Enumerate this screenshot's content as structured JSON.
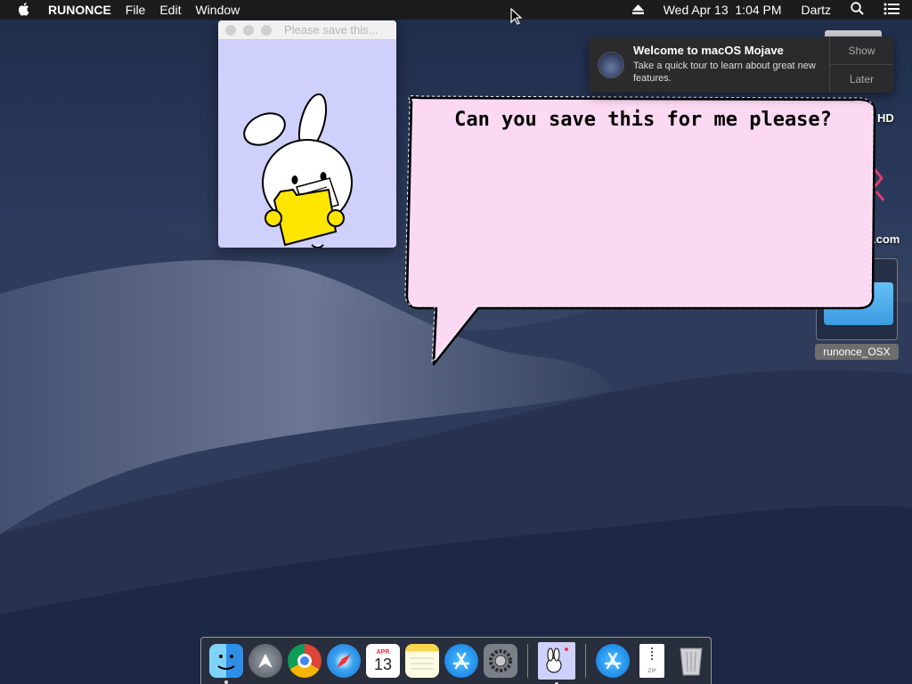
{
  "menubar": {
    "app_name": "RUNONCE",
    "menus": [
      "File",
      "Edit",
      "Window"
    ],
    "date_time": "Wed Apr 13  1:04 PM",
    "user": "Dartz"
  },
  "app_window": {
    "title": "Please save this..."
  },
  "speech_bubble": {
    "text": "Can you save this for me please?"
  },
  "notification": {
    "title": "Welcome to macOS Mojave",
    "body": "Take a quick tour to learn about great new features.",
    "show_label": "Show",
    "later_label": "Later"
  },
  "desktop": {
    "partial_label_1": "HD",
    "partial_label_2": ".com",
    "folder_label": "runonce_OSX"
  },
  "dock": {
    "calendar_month": "APR",
    "calendar_day": "13",
    "items": [
      "finder-icon",
      "launchpad-icon",
      "chrome-icon",
      "safari-icon",
      "calendar-icon",
      "notes-icon",
      "app-store-icon",
      "system-preferences-icon",
      "runonce-icon",
      "app-store-icon",
      "zip-file-icon",
      "trash-icon"
    ]
  }
}
